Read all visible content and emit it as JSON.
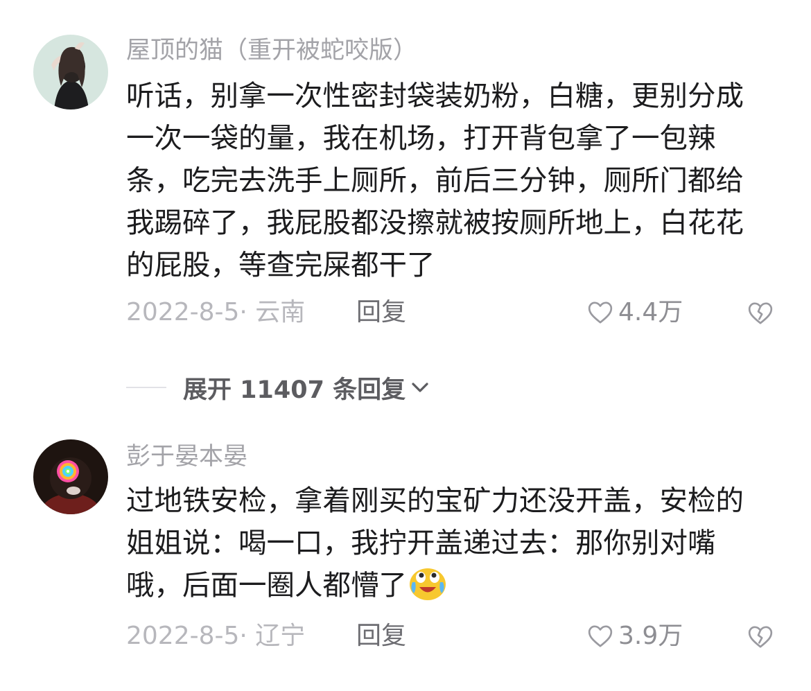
{
  "comments": [
    {
      "username": "屋顶的猫（重开被蛇咬版）",
      "avatar_icon": "avatar-girl-photo",
      "text": "听话，别拿一次性密封袋装奶粉，白糖，更别分成一次一袋的量，我在机场，打开背包拿了一包辣条，吃完去洗手上厕所，前后三分钟，厕所门都给我踢碎了，我屁股都没擦就被按厕所地上，白花花的屁股，等查完屎都干了",
      "date_location": "2022-8-5· 云南",
      "reply_label": "回复",
      "likes": "4.4万"
    },
    {
      "username": "彭于晏本晏",
      "avatar_icon": "avatar-rainbow-photo",
      "text": "过地铁安检，拿着刚买的宝矿力还没开盖，安检的姐姐说：喝一口，我拧开盖递过去：那你别对嘴哦，后面一圈人都懵了",
      "emoji": "crying-laughing-emoji",
      "date_location": "2022-8-5· 辽宁",
      "reply_label": "回复",
      "likes": "3.9万"
    }
  ],
  "expand_replies": {
    "label": "展开 11407 条回复",
    "icon": "chevron-down-icon"
  },
  "icons": {
    "like": "heart-outline-icon",
    "dislike": "broken-heart-icon"
  },
  "colors": {
    "username": "#a3a3a8",
    "body": "#1c1c1e",
    "meta": "#b7b7bc",
    "reply": "#6d6d72",
    "icon": "#9a9aa0",
    "emoji": "#f7c82f"
  }
}
